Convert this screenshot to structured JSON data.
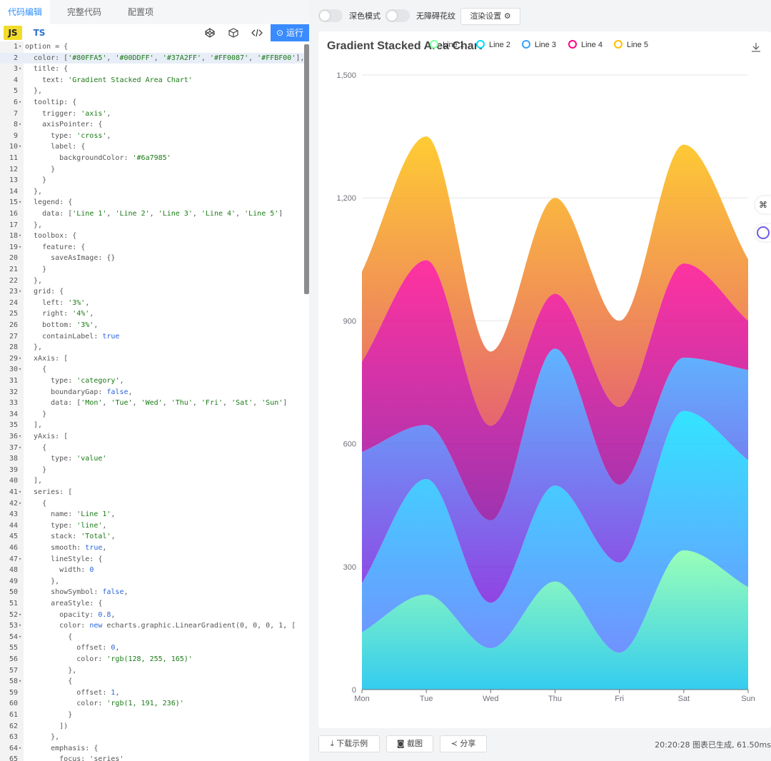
{
  "tabs": [
    {
      "label": "代码编辑",
      "active": true
    },
    {
      "label": "完整代码",
      "active": false
    },
    {
      "label": "配置项",
      "active": false
    }
  ],
  "lang": {
    "js": "JS",
    "ts": "TS"
  },
  "run_label": "运行",
  "code_lines": [
    [
      {
        "t": "option = {",
        "c": "p"
      }
    ],
    [
      {
        "t": "  color: [",
        "c": "p"
      },
      {
        "t": "'#80FFA5'",
        "c": "s"
      },
      {
        "t": ", ",
        "c": "p"
      },
      {
        "t": "'#00DDFF'",
        "c": "s"
      },
      {
        "t": ", ",
        "c": "p"
      },
      {
        "t": "'#37A2FF'",
        "c": "s"
      },
      {
        "t": ", ",
        "c": "p"
      },
      {
        "t": "'#FF0087'",
        "c": "s"
      },
      {
        "t": ", ",
        "c": "p"
      },
      {
        "t": "'#FFBF00'",
        "c": "s"
      },
      {
        "t": "],",
        "c": "p"
      }
    ],
    [
      {
        "t": "  title: {",
        "c": "p"
      }
    ],
    [
      {
        "t": "    text: ",
        "c": "p"
      },
      {
        "t": "'Gradient Stacked Area Chart'",
        "c": "s"
      }
    ],
    [
      {
        "t": "  },",
        "c": "p"
      }
    ],
    [
      {
        "t": "  tooltip: {",
        "c": "p"
      }
    ],
    [
      {
        "t": "    trigger: ",
        "c": "p"
      },
      {
        "t": "'axis'",
        "c": "s"
      },
      {
        "t": ",",
        "c": "p"
      }
    ],
    [
      {
        "t": "    axisPointer: {",
        "c": "p"
      }
    ],
    [
      {
        "t": "      type: ",
        "c": "p"
      },
      {
        "t": "'cross'",
        "c": "s"
      },
      {
        "t": ",",
        "c": "p"
      }
    ],
    [
      {
        "t": "      label: {",
        "c": "p"
      }
    ],
    [
      {
        "t": "        backgroundColor: ",
        "c": "p"
      },
      {
        "t": "'#6a7985'",
        "c": "s"
      }
    ],
    [
      {
        "t": "      }",
        "c": "p"
      }
    ],
    [
      {
        "t": "    }",
        "c": "p"
      }
    ],
    [
      {
        "t": "  },",
        "c": "p"
      }
    ],
    [
      {
        "t": "  legend: {",
        "c": "p"
      }
    ],
    [
      {
        "t": "    data: [",
        "c": "p"
      },
      {
        "t": "'Line 1'",
        "c": "s"
      },
      {
        "t": ", ",
        "c": "p"
      },
      {
        "t": "'Line 2'",
        "c": "s"
      },
      {
        "t": ", ",
        "c": "p"
      },
      {
        "t": "'Line 3'",
        "c": "s"
      },
      {
        "t": ", ",
        "c": "p"
      },
      {
        "t": "'Line 4'",
        "c": "s"
      },
      {
        "t": ", ",
        "c": "p"
      },
      {
        "t": "'Line 5'",
        "c": "s"
      },
      {
        "t": "]",
        "c": "p"
      }
    ],
    [
      {
        "t": "  },",
        "c": "p"
      }
    ],
    [
      {
        "t": "  toolbox: {",
        "c": "p"
      }
    ],
    [
      {
        "t": "    feature: {",
        "c": "p"
      }
    ],
    [
      {
        "t": "      saveAsImage: {}",
        "c": "p"
      }
    ],
    [
      {
        "t": "    }",
        "c": "p"
      }
    ],
    [
      {
        "t": "  },",
        "c": "p"
      }
    ],
    [
      {
        "t": "  grid: {",
        "c": "p"
      }
    ],
    [
      {
        "t": "    left: ",
        "c": "p"
      },
      {
        "t": "'3%'",
        "c": "s"
      },
      {
        "t": ",",
        "c": "p"
      }
    ],
    [
      {
        "t": "    right: ",
        "c": "p"
      },
      {
        "t": "'4%'",
        "c": "s"
      },
      {
        "t": ",",
        "c": "p"
      }
    ],
    [
      {
        "t": "    bottom: ",
        "c": "p"
      },
      {
        "t": "'3%'",
        "c": "s"
      },
      {
        "t": ",",
        "c": "p"
      }
    ],
    [
      {
        "t": "    containLabel: ",
        "c": "p"
      },
      {
        "t": "true",
        "c": "k"
      }
    ],
    [
      {
        "t": "  },",
        "c": "p"
      }
    ],
    [
      {
        "t": "  xAxis: [",
        "c": "p"
      }
    ],
    [
      {
        "t": "    {",
        "c": "p"
      }
    ],
    [
      {
        "t": "      type: ",
        "c": "p"
      },
      {
        "t": "'category'",
        "c": "s"
      },
      {
        "t": ",",
        "c": "p"
      }
    ],
    [
      {
        "t": "      boundaryGap: ",
        "c": "p"
      },
      {
        "t": "false",
        "c": "k"
      },
      {
        "t": ",",
        "c": "p"
      }
    ],
    [
      {
        "t": "      data: [",
        "c": "p"
      },
      {
        "t": "'Mon'",
        "c": "s"
      },
      {
        "t": ", ",
        "c": "p"
      },
      {
        "t": "'Tue'",
        "c": "s"
      },
      {
        "t": ", ",
        "c": "p"
      },
      {
        "t": "'Wed'",
        "c": "s"
      },
      {
        "t": ", ",
        "c": "p"
      },
      {
        "t": "'Thu'",
        "c": "s"
      },
      {
        "t": ", ",
        "c": "p"
      },
      {
        "t": "'Fri'",
        "c": "s"
      },
      {
        "t": ", ",
        "c": "p"
      },
      {
        "t": "'Sat'",
        "c": "s"
      },
      {
        "t": ", ",
        "c": "p"
      },
      {
        "t": "'Sun'",
        "c": "s"
      },
      {
        "t": "]",
        "c": "p"
      }
    ],
    [
      {
        "t": "    }",
        "c": "p"
      }
    ],
    [
      {
        "t": "  ],",
        "c": "p"
      }
    ],
    [
      {
        "t": "  yAxis: [",
        "c": "p"
      }
    ],
    [
      {
        "t": "    {",
        "c": "p"
      }
    ],
    [
      {
        "t": "      type: ",
        "c": "p"
      },
      {
        "t": "'value'",
        "c": "s"
      }
    ],
    [
      {
        "t": "    }",
        "c": "p"
      }
    ],
    [
      {
        "t": "  ],",
        "c": "p"
      }
    ],
    [
      {
        "t": "  series: [",
        "c": "p"
      }
    ],
    [
      {
        "t": "    {",
        "c": "p"
      }
    ],
    [
      {
        "t": "      name: ",
        "c": "p"
      },
      {
        "t": "'Line 1'",
        "c": "s"
      },
      {
        "t": ",",
        "c": "p"
      }
    ],
    [
      {
        "t": "      type: ",
        "c": "p"
      },
      {
        "t": "'line'",
        "c": "s"
      },
      {
        "t": ",",
        "c": "p"
      }
    ],
    [
      {
        "t": "      stack: ",
        "c": "p"
      },
      {
        "t": "'Total'",
        "c": "s"
      },
      {
        "t": ",",
        "c": "p"
      }
    ],
    [
      {
        "t": "      smooth: ",
        "c": "p"
      },
      {
        "t": "true",
        "c": "k"
      },
      {
        "t": ",",
        "c": "p"
      }
    ],
    [
      {
        "t": "      lineStyle: {",
        "c": "p"
      }
    ],
    [
      {
        "t": "        width: ",
        "c": "p"
      },
      {
        "t": "0",
        "c": "k"
      }
    ],
    [
      {
        "t": "      },",
        "c": "p"
      }
    ],
    [
      {
        "t": "      showSymbol: ",
        "c": "p"
      },
      {
        "t": "false",
        "c": "k"
      },
      {
        "t": ",",
        "c": "p"
      }
    ],
    [
      {
        "t": "      areaStyle: {",
        "c": "p"
      }
    ],
    [
      {
        "t": "        opacity: ",
        "c": "p"
      },
      {
        "t": "0.8",
        "c": "k"
      },
      {
        "t": ",",
        "c": "p"
      }
    ],
    [
      {
        "t": "        color: ",
        "c": "p"
      },
      {
        "t": "new",
        "c": "k"
      },
      {
        "t": " echarts.graphic.LinearGradient(0, 0, 0, 1, [",
        "c": "p"
      }
    ],
    [
      {
        "t": "          {",
        "c": "p"
      }
    ],
    [
      {
        "t": "            offset: ",
        "c": "p"
      },
      {
        "t": "0",
        "c": "k"
      },
      {
        "t": ",",
        "c": "p"
      }
    ],
    [
      {
        "t": "            color: ",
        "c": "p"
      },
      {
        "t": "'rgb(128, 255, 165)'",
        "c": "s"
      }
    ],
    [
      {
        "t": "          },",
        "c": "p"
      }
    ],
    [
      {
        "t": "          {",
        "c": "p"
      }
    ],
    [
      {
        "t": "            offset: ",
        "c": "p"
      },
      {
        "t": "1",
        "c": "k"
      },
      {
        "t": ",",
        "c": "p"
      }
    ],
    [
      {
        "t": "            color: ",
        "c": "p"
      },
      {
        "t": "'rgb(1, 191, 236)'",
        "c": "s"
      }
    ],
    [
      {
        "t": "          }",
        "c": "p"
      }
    ],
    [
      {
        "t": "        ])",
        "c": "p"
      }
    ],
    [
      {
        "t": "      },",
        "c": "p"
      }
    ],
    [
      {
        "t": "      emphasis: {",
        "c": "p"
      }
    ],
    [
      {
        "t": "        focus: 'series'",
        "c": "p"
      }
    ]
  ],
  "fold_lines": [
    1,
    3,
    6,
    8,
    10,
    15,
    18,
    19,
    23,
    29,
    30,
    36,
    37,
    41,
    42,
    47,
    52,
    53,
    54,
    58,
    64
  ],
  "highlight_line": 2,
  "controls": {
    "dark_mode": "深色模式",
    "decal": "无障碍花纹",
    "render_settings": "渲染设置"
  },
  "bottom": {
    "download": "下载示例",
    "screenshot": "截图",
    "share": "分享",
    "status": "20:20:28  图表已生成, 61.50ms"
  },
  "chart_data": {
    "type": "area",
    "title": "Gradient Stacked Area Chart",
    "categories": [
      "Mon",
      "Tue",
      "Wed",
      "Thu",
      "Fri",
      "Sat",
      "Sun"
    ],
    "ylim": [
      0,
      1500
    ],
    "yticks": [
      "0",
      "300",
      "600",
      "900",
      "1,200",
      "1,500"
    ],
    "stacked": true,
    "smooth": true,
    "legend_position": "top",
    "series": [
      {
        "name": "Line 1",
        "values": [
          140,
          232,
          101,
          264,
          90,
          340,
          250
        ],
        "color": "#80FFA5",
        "grad": [
          "rgb(128,255,165)",
          "rgb(1,191,236)"
        ]
      },
      {
        "name": "Line 2",
        "values": [
          120,
          282,
          111,
          234,
          220,
          340,
          310
        ],
        "color": "#00DDFF",
        "grad": [
          "rgb(0,221,255)",
          "rgb(77,119,255)"
        ]
      },
      {
        "name": "Line 3",
        "values": [
          320,
          132,
          201,
          334,
          190,
          130,
          220
        ],
        "color": "#37A2FF",
        "grad": [
          "rgb(55,162,255)",
          "rgb(116,21,219)"
        ]
      },
      {
        "name": "Line 4",
        "values": [
          220,
          402,
          231,
          134,
          190,
          230,
          120
        ],
        "color": "#FF0087",
        "grad": [
          "rgb(255,0,135)",
          "rgb(135,0,157)"
        ]
      },
      {
        "name": "Line 5",
        "values": [
          220,
          302,
          181,
          234,
          210,
          290,
          150
        ],
        "color": "#FFBF00",
        "grad": [
          "rgb(255,191,0)",
          "rgb(224,62,76)"
        ]
      }
    ]
  }
}
